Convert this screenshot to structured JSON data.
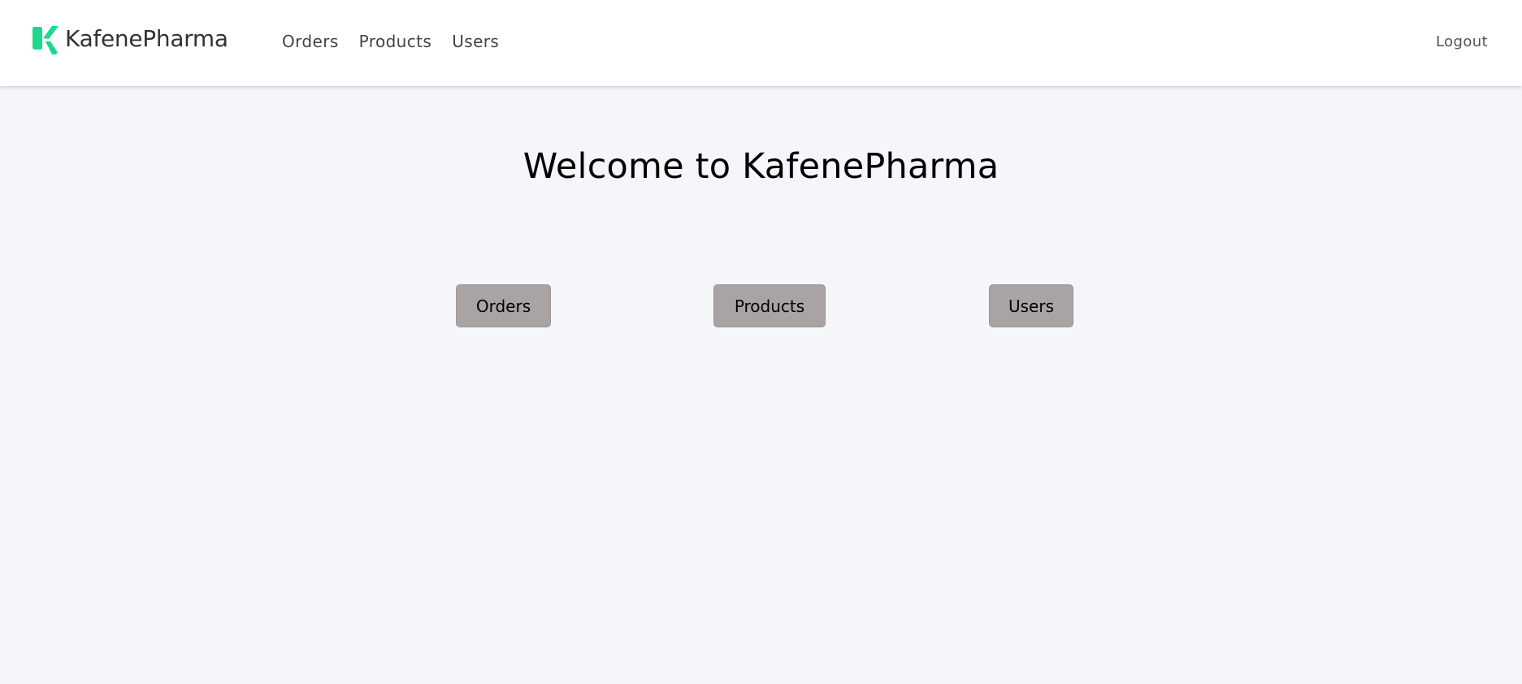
{
  "brand": {
    "name": "KafenePharma",
    "icon": "kafene-k-logo-icon",
    "accent_color": "#1fd88d"
  },
  "nav": {
    "items": [
      {
        "label": "Orders"
      },
      {
        "label": "Products"
      },
      {
        "label": "Users"
      }
    ],
    "logout_label": "Logout"
  },
  "main": {
    "heading": "Welcome to KafenePharma",
    "buttons": [
      {
        "label": "Orders"
      },
      {
        "label": "Products"
      },
      {
        "label": "Users"
      }
    ]
  },
  "colors": {
    "page_background": "#f5f6fa",
    "header_background": "#ffffff",
    "button_background": "#aaa3a3"
  }
}
